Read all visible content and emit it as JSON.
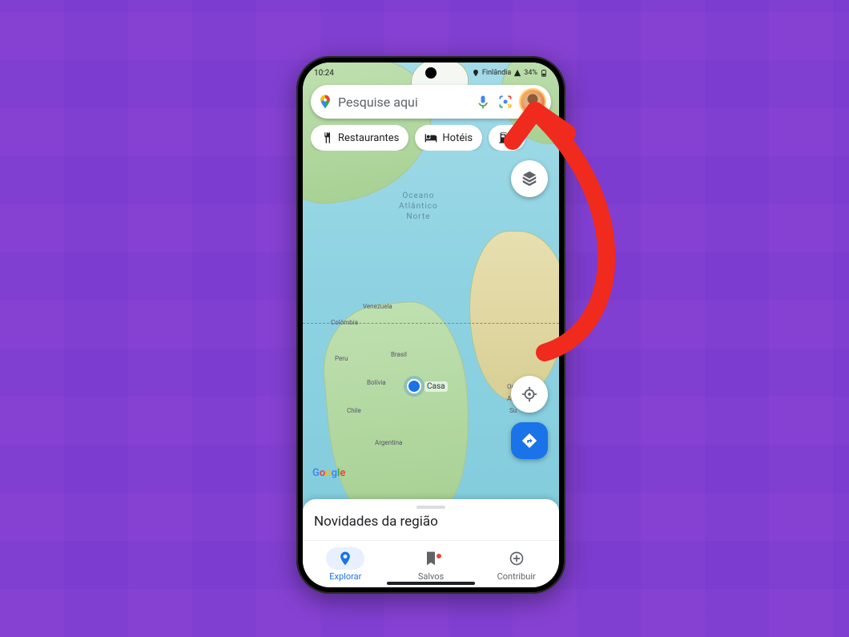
{
  "status": {
    "time": "10:24",
    "carrier_text": "Finlândia",
    "battery_text": "34%"
  },
  "search": {
    "placeholder": "Pesquise aqui"
  },
  "chips": [
    {
      "icon": "restaurant-icon",
      "label": "Restaurantes"
    },
    {
      "icon": "hotel-icon",
      "label": "Hotéis"
    },
    {
      "icon": "gas-icon",
      "label": ""
    }
  ],
  "map": {
    "ocean_label_line1": "Oceano",
    "ocean_label_line2": "Atlântico",
    "ocean_label_line3": "Norte",
    "home_label": "Casa",
    "country_labels": {
      "venezuela": "Venezuela",
      "colombia": "Colômbia",
      "peru": "Peru",
      "brasil": "Brasil",
      "bolivia": "Bolívia",
      "chile": "Chile",
      "argentina": "Argentina",
      "oc_sul1": "Oc",
      "oc_sul2": "Atlâ",
      "oc_sul3": "Su"
    },
    "watermark": "Google"
  },
  "sheet": {
    "title": "Novidades da região"
  },
  "nav": {
    "explore": "Explorar",
    "saved": "Salvos",
    "contribute": "Contribuir"
  },
  "annotation": {
    "arrow_target": "avatar-profile-button",
    "arrow_color": "#f02a1d"
  }
}
